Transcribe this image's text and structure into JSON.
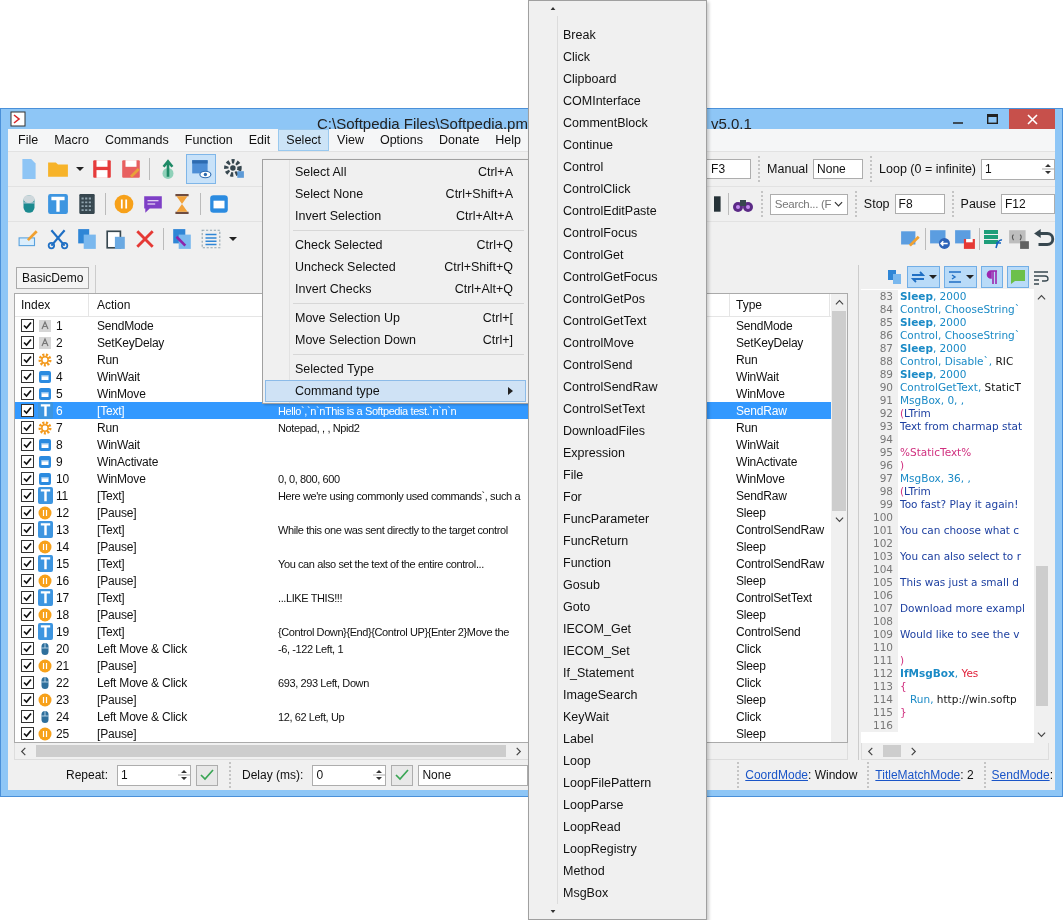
{
  "window": {
    "title_start": "C:\\Softpedia Files\\Softpedia.pm",
    "title_end": "v5.0.1"
  },
  "menu_bar": [
    {
      "label": "File",
      "selected": false
    },
    {
      "label": "Macro",
      "selected": false
    },
    {
      "label": "Commands",
      "selected": false
    },
    {
      "label": "Function",
      "selected": false
    },
    {
      "label": "Edit",
      "selected": false
    },
    {
      "label": "Select",
      "selected": true
    },
    {
      "label": "View",
      "selected": false
    },
    {
      "label": "Options",
      "selected": false
    },
    {
      "label": "Donate",
      "selected": false
    },
    {
      "label": "Help",
      "selected": false
    }
  ],
  "toolbar": {
    "preview_on": true,
    "hotkey_value": "F3",
    "manual_label": "Manual",
    "manual_value": "None",
    "loop_label": "Loop (0 = infinite)",
    "loop_value": "1",
    "search_placeholder": "Search... (F",
    "stop_label": "Stop",
    "stop_value": "F8",
    "pause_label": "Pause",
    "pause_value": "F12"
  },
  "tabs": [
    {
      "label": "BasicDemo",
      "selected": true
    }
  ],
  "table": {
    "columns": [
      "Index",
      "Action",
      "Type"
    ],
    "rows": [
      {
        "index": "1",
        "action": "SendMode",
        "kind": "mode",
        "checked": true,
        "selected": false,
        "type": "SendMode"
      },
      {
        "index": "2",
        "action": "SetKeyDelay",
        "kind": "mode",
        "checked": true,
        "selected": false,
        "type": "SetKeyDelay"
      },
      {
        "index": "3",
        "action": "Run",
        "kind": "run",
        "checked": true,
        "selected": false,
        "type": "Run"
      },
      {
        "index": "4",
        "action": "WinWait",
        "kind": "window",
        "checked": true,
        "selected": false,
        "type": "WinWait"
      },
      {
        "index": "5",
        "action": "WinMove",
        "kind": "window",
        "checked": true,
        "selected": false,
        "type": "WinMove"
      },
      {
        "index": "6",
        "action": "[Text]",
        "kind": "text",
        "checked": true,
        "selected": true,
        "column_3": "Hello`,`n`nThis is a Softpedia test.`n`n`n",
        "type": "SendRaw"
      },
      {
        "index": "7",
        "action": "Run",
        "kind": "run",
        "checked": true,
        "selected": false,
        "column_3": "Notepad, , , Npid2",
        "type": "Run"
      },
      {
        "index": "8",
        "action": "WinWait",
        "kind": "window",
        "checked": true,
        "selected": false,
        "type": "WinWait"
      },
      {
        "index": "9",
        "action": "WinActivate",
        "kind": "window",
        "checked": true,
        "selected": false,
        "type": "WinActivate"
      },
      {
        "index": "10",
        "action": "WinMove",
        "kind": "window",
        "checked": true,
        "selected": false,
        "column_3": "0, 0, 800, 600",
        "type": "WinMove"
      },
      {
        "index": "11",
        "action": "[Text]",
        "kind": "text",
        "checked": true,
        "selected": false,
        "column_3": "Here we're using commonly used commands`, such a",
        "type": "SendRaw"
      },
      {
        "index": "12",
        "action": "[Pause]",
        "kind": "pause",
        "checked": true,
        "selected": false,
        "type": "Sleep"
      },
      {
        "index": "13",
        "action": "[Text]",
        "kind": "text",
        "checked": true,
        "selected": false,
        "column_3": "While this one was sent directly to the target control",
        "type": "ControlSendRaw"
      },
      {
        "index": "14",
        "action": "[Pause]",
        "kind": "pause",
        "checked": true,
        "selected": false,
        "type": "Sleep"
      },
      {
        "index": "15",
        "action": "[Text]",
        "kind": "text",
        "checked": true,
        "selected": false,
        "column_3": "You can also set the text of the entire control...",
        "type": "ControlSendRaw"
      },
      {
        "index": "16",
        "action": "[Pause]",
        "kind": "pause",
        "checked": true,
        "selected": false,
        "type": "Sleep"
      },
      {
        "index": "17",
        "action": "[Text]",
        "kind": "text",
        "checked": true,
        "selected": false,
        "column_3": "...LIKE THIS!!!",
        "type": "ControlSetText"
      },
      {
        "index": "18",
        "action": "[Pause]",
        "kind": "pause",
        "checked": true,
        "selected": false,
        "type": "Sleep"
      },
      {
        "index": "19",
        "action": "[Text]",
        "kind": "text",
        "checked": true,
        "selected": false,
        "column_3": "{Control Down}{End}{Control UP}{Enter 2}Move the",
        "type": "ControlSend"
      },
      {
        "index": "20",
        "action": "Left Move & Click",
        "kind": "mouse",
        "checked": true,
        "selected": false,
        "column_3": "-6, -122 Left, 1",
        "type": "Click"
      },
      {
        "index": "21",
        "action": "[Pause]",
        "kind": "pause",
        "checked": true,
        "selected": false,
        "type": "Sleep"
      },
      {
        "index": "22",
        "action": "Left Move & Click",
        "kind": "mouse",
        "checked": true,
        "selected": false,
        "column_3": "693, 293 Left, Down",
        "type": "Click"
      },
      {
        "index": "23",
        "action": "[Pause]",
        "kind": "pause",
        "checked": true,
        "selected": false,
        "type": "Sleep"
      },
      {
        "index": "24",
        "action": "Left Move & Click",
        "kind": "mouse",
        "checked": true,
        "selected": false,
        "column_3": "12, 62 Left, Up",
        "type": "Click"
      },
      {
        "index": "25",
        "action": "[Pause]",
        "kind": "pause",
        "checked": true,
        "selected": false,
        "type": "Sleep"
      }
    ]
  },
  "editor": {
    "toggles_on": true,
    "lines": [
      {
        "number": "83",
        "tokens": [
          {
            "kind": "keyword",
            "text": "Sleep"
          },
          {
            "kind": "punct",
            "text": ", 2000"
          }
        ]
      },
      {
        "number": "84",
        "tokens": [
          {
            "kind": "command",
            "text": "Control, ChooseString`"
          }
        ]
      },
      {
        "number": "85",
        "tokens": [
          {
            "kind": "keyword",
            "text": "Sleep"
          },
          {
            "kind": "punct",
            "text": ", 2000"
          }
        ]
      },
      {
        "number": "86",
        "tokens": [
          {
            "kind": "command",
            "text": "Control, ChooseString`"
          }
        ]
      },
      {
        "number": "87",
        "tokens": [
          {
            "kind": "keyword",
            "text": "Sleep"
          },
          {
            "kind": "punct",
            "text": ", 2000"
          }
        ]
      },
      {
        "number": "88",
        "tokens": [
          {
            "kind": "command",
            "text": "Control, Disable`, "
          },
          {
            "kind": "param",
            "text": "RIC"
          }
        ]
      },
      {
        "number": "89",
        "tokens": [
          {
            "kind": "keyword",
            "text": "Sleep"
          },
          {
            "kind": "punct",
            "text": ", 2000"
          }
        ]
      },
      {
        "number": "90",
        "tokens": [
          {
            "kind": "command",
            "text": "ControlGetText, "
          },
          {
            "kind": "param",
            "text": "StaticT"
          }
        ]
      },
      {
        "number": "91",
        "tokens": [
          {
            "kind": "command",
            "text": "MsgBox, 0, ,"
          }
        ]
      },
      {
        "number": "92",
        "tokens": [
          {
            "kind": "bracket",
            "text": "("
          },
          {
            "kind": "text",
            "text": "LTrim"
          }
        ]
      },
      {
        "number": "93",
        "tokens": [
          {
            "kind": "text",
            "text": "Text from charmap stat"
          }
        ]
      },
      {
        "number": "94"
      },
      {
        "number": "95",
        "tokens": [
          {
            "kind": "var",
            "text": "%StaticText%"
          }
        ]
      },
      {
        "number": "96",
        "tokens": [
          {
            "kind": "bracket",
            "text": ")"
          }
        ]
      },
      {
        "number": "97",
        "tokens": [
          {
            "kind": "command",
            "text": "MsgBox, 36, ,"
          }
        ]
      },
      {
        "number": "98",
        "tokens": [
          {
            "kind": "bracket",
            "text": "("
          },
          {
            "kind": "text",
            "text": "LTrim"
          }
        ]
      },
      {
        "number": "99",
        "tokens": [
          {
            "kind": "text",
            "text": "Too fast? Play it again!"
          }
        ]
      },
      {
        "number": "100"
      },
      {
        "number": "101",
        "tokens": [
          {
            "kind": "text",
            "text": "You can choose what c"
          }
        ]
      },
      {
        "number": "102"
      },
      {
        "number": "103",
        "tokens": [
          {
            "kind": "text",
            "text": "You can also select to r"
          }
        ]
      },
      {
        "number": "104"
      },
      {
        "number": "105",
        "tokens": [
          {
            "kind": "text",
            "text": "This was just a small d"
          }
        ]
      },
      {
        "number": "106"
      },
      {
        "number": "107",
        "tokens": [
          {
            "kind": "text",
            "text": "Download more exampl"
          }
        ]
      },
      {
        "number": "108"
      },
      {
        "number": "109",
        "tokens": [
          {
            "kind": "text",
            "text": "Would like to see the v"
          }
        ]
      },
      {
        "number": "110"
      },
      {
        "number": "111",
        "tokens": [
          {
            "kind": "bracket",
            "text": ")"
          }
        ]
      },
      {
        "number": "112",
        "tokens": [
          {
            "kind": "keyword",
            "text": "IfMsgBox"
          },
          {
            "kind": "punct",
            "text": ", "
          },
          {
            "kind": "value",
            "text": "Yes"
          }
        ]
      },
      {
        "number": "113",
        "tokens": [
          {
            "kind": "bracket",
            "text": "{"
          }
        ]
      },
      {
        "number": "114",
        "tokens": [
          {
            "kind": "command",
            "text": "   Run, "
          },
          {
            "kind": "param",
            "text": "http://win.softp"
          }
        ]
      },
      {
        "number": "115",
        "tokens": [
          {
            "kind": "bracket",
            "text": "}"
          }
        ]
      },
      {
        "number": "116"
      }
    ]
  },
  "status_bar": {
    "repeat_label": "Repeat:",
    "repeat_value": "1",
    "delay_label": "Delay (ms):",
    "delay_value": "0",
    "combo_value": "None",
    "settings": [
      {
        "link": "CoordMode",
        "value": ": Window"
      },
      {
        "link": "TitleMatchMode",
        "value": ": 2"
      },
      {
        "link": "SendMode",
        "value": ":"
      }
    ]
  },
  "select_menu": [
    {
      "kind": "item",
      "label": "Select All",
      "shortcut": "Ctrl+A",
      "selected": false
    },
    {
      "kind": "item",
      "label": "Select None",
      "shortcut": "Ctrl+Shift+A",
      "selected": false
    },
    {
      "kind": "item",
      "label": "Invert Selection",
      "shortcut": "Ctrl+Alt+A",
      "selected": false
    },
    {
      "kind": "separator"
    },
    {
      "kind": "item",
      "label": "Check Selected",
      "shortcut": "Ctrl+Q",
      "selected": false
    },
    {
      "kind": "item",
      "label": "Uncheck Selected",
      "shortcut": "Ctrl+Shift+Q",
      "selected": false
    },
    {
      "kind": "item",
      "label": "Invert Checks",
      "shortcut": "Ctrl+Alt+Q",
      "selected": false
    },
    {
      "kind": "separator"
    },
    {
      "kind": "item",
      "label": "Move Selection Up",
      "shortcut": "Ctrl+[",
      "selected": false
    },
    {
      "kind": "item",
      "label": "Move Selection Down",
      "shortcut": "Ctrl+]",
      "selected": false
    },
    {
      "kind": "separator"
    },
    {
      "kind": "item",
      "label": "Selected Type",
      "selected": false
    },
    {
      "kind": "submenu",
      "label": "Command type",
      "selected": true
    }
  ],
  "command_type_menu": [
    "Break",
    "Click",
    "Clipboard",
    "COMInterface",
    "CommentBlock",
    "Continue",
    "Control",
    "ControlClick",
    "ControlEditPaste",
    "ControlFocus",
    "ControlGet",
    "ControlGetFocus",
    "ControlGetPos",
    "ControlGetText",
    "ControlMove",
    "ControlSend",
    "ControlSendRaw",
    "ControlSetText",
    "DownloadFiles",
    "Expression",
    "File",
    "For",
    "FuncParameter",
    "FuncReturn",
    "Function",
    "Gosub",
    "Goto",
    "IECOM_Get",
    "IECOM_Set",
    "If_Statement",
    "ImageSearch",
    "KeyWait",
    "Label",
    "Loop",
    "LoopFilePattern",
    "LoopParse",
    "LoopRead",
    "LoopRegistry",
    "Method",
    "MsgBox"
  ]
}
